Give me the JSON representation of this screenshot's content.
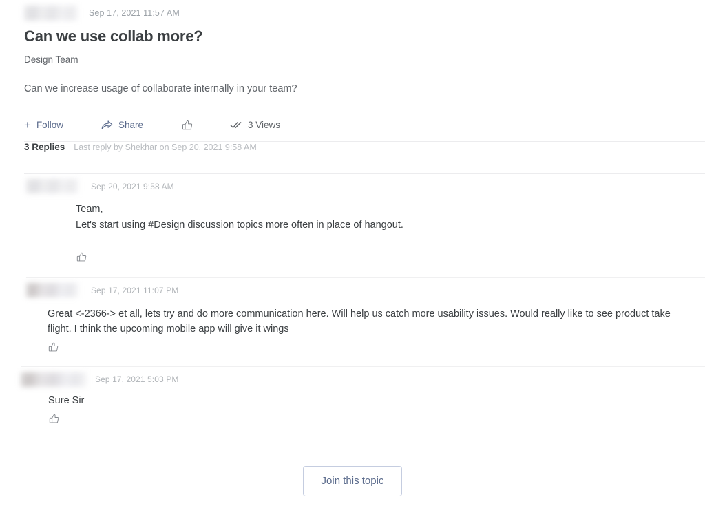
{
  "topic": {
    "author_redacted": true,
    "timestamp": "Sep 17, 2021 11:57 AM",
    "title": "Can we use collab more?",
    "group": "Design Team",
    "body": "Can we increase usage of collaborate internally in your team?"
  },
  "actions": {
    "follow_label": "Follow",
    "follow_icon": "plus-icon",
    "share_label": "Share",
    "share_icon": "share-arrow-icon",
    "like_icon": "thumbs-up-icon",
    "views_label": "3 Views",
    "views_icon": "double-check-icon"
  },
  "replies_header": {
    "count_label": "3 Replies",
    "last_reply": "Last reply by Shekhar on Sep 20, 2021 9:58 AM"
  },
  "replies": [
    {
      "author_redacted": true,
      "timestamp": "Sep 20, 2021 9:58 AM",
      "lines": [
        "Team,",
        "Let's start using #Design discussion topics more often in place of hangout."
      ],
      "like_icon": "thumbs-up-icon"
    },
    {
      "author_redacted": true,
      "timestamp": "Sep 17, 2021 11:07 PM",
      "lines": [
        "Great <-2366-> et all, lets try and do more communication here. Will help us catch more usability issues. Would really like to see product take flight. I think the upcoming mobile app will give it wings"
      ],
      "like_icon": "thumbs-up-icon"
    },
    {
      "author_redacted": true,
      "timestamp": "Sep 17, 2021 5:03 PM",
      "lines": [
        "Sure Sir"
      ],
      "like_icon": "thumbs-up-icon"
    }
  ],
  "footer": {
    "join_label": "Join this topic"
  },
  "colors": {
    "accent": "#5b6b8c",
    "text_primary": "#3c4043",
    "text_secondary": "#5f6368",
    "text_muted": "#b9bcc0",
    "divider": "#ececee",
    "button_border": "#c5cde0",
    "background": "#ffffff"
  }
}
